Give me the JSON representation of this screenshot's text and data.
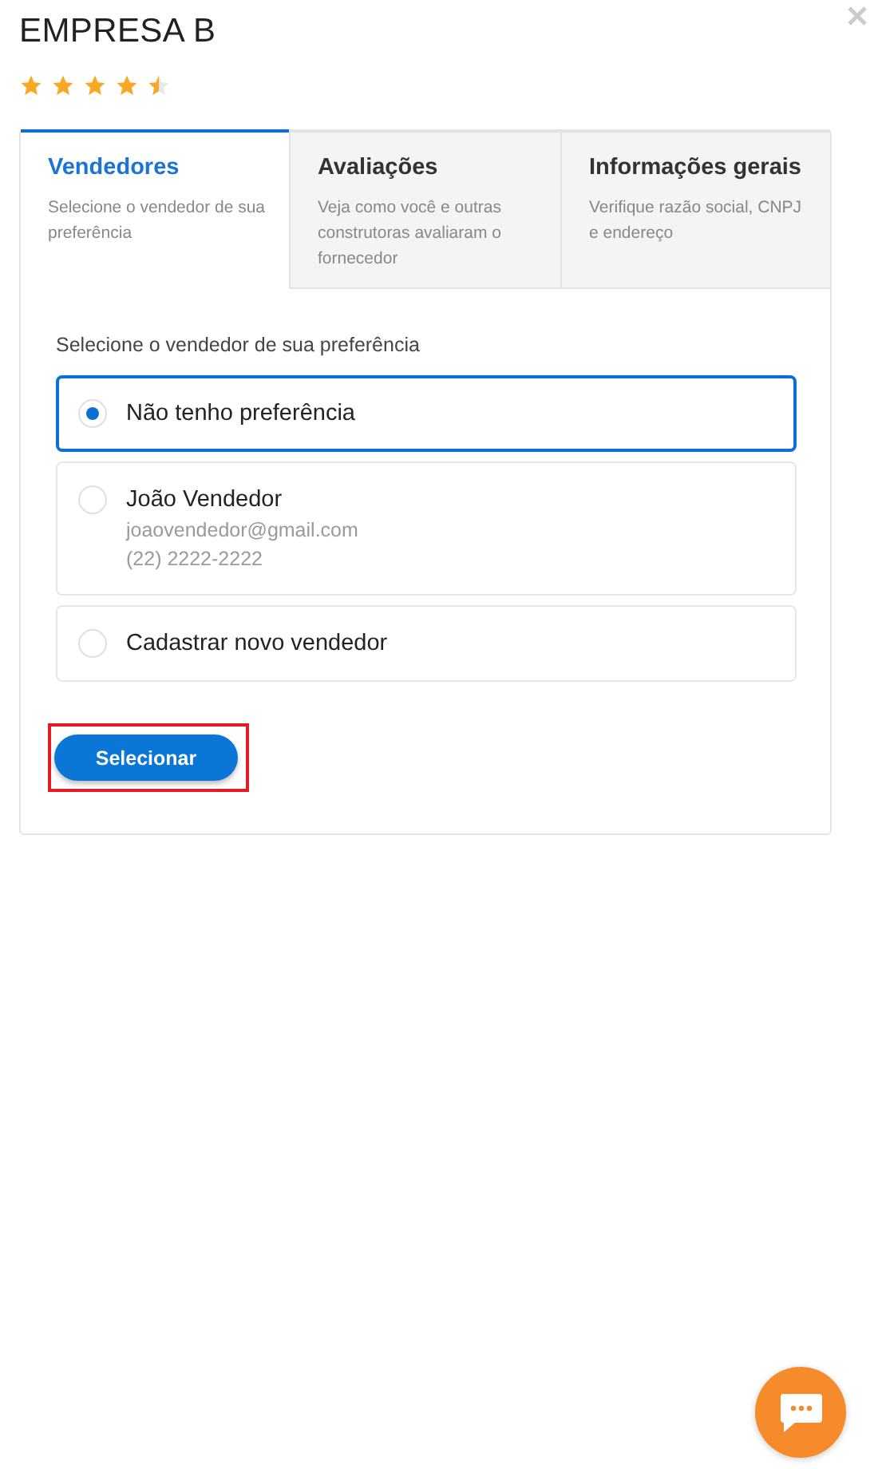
{
  "title": "EMPRESA B",
  "rating": {
    "stars": 4.5
  },
  "tabs": [
    {
      "label": "Vendedores",
      "description": "Selecione o vendedor de sua preferência",
      "selected": true
    },
    {
      "label": "Avaliações",
      "description": "Veja como você e outras construtoras avaliaram o fornecedor",
      "selected": false
    },
    {
      "label": "Informações gerais",
      "description": "Verifique razão social, CNPJ e endereço",
      "selected": false
    }
  ],
  "prompt": "Selecione o vendedor de sua preferência",
  "options": [
    {
      "label": "Não tenho preferência",
      "selected": true
    },
    {
      "label": "João Vendedor",
      "email": "joaovendedor@gmail.com",
      "phone": "(22) 2222-2222",
      "selected": false
    },
    {
      "label": "Cadastrar novo vendedor",
      "selected": false
    }
  ],
  "button": {
    "label": "Selecionar",
    "highlighted": true
  }
}
